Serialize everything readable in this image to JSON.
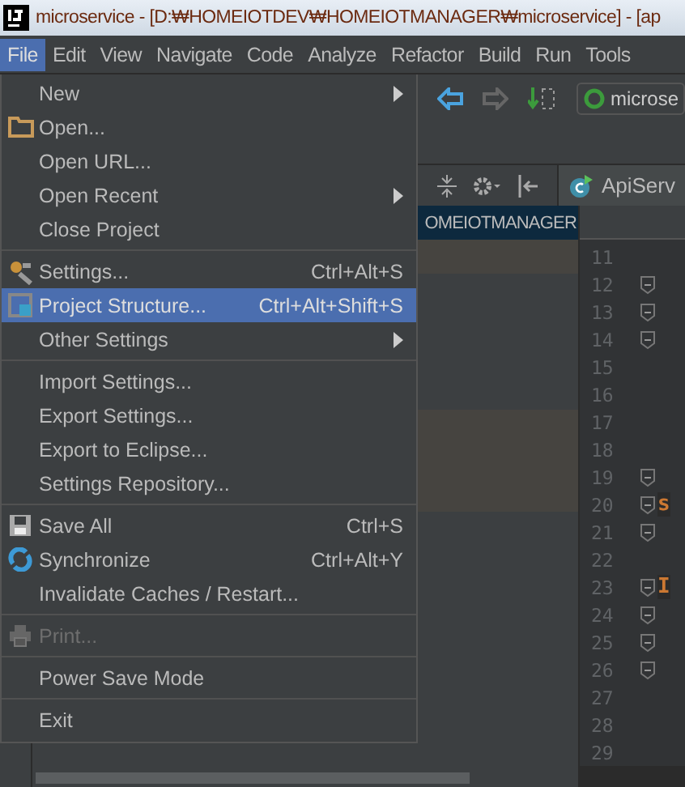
{
  "window": {
    "title": "microservice - [D:₩HOMEIOTDEV₩HOMEIOTMANAGER₩microservice] - [ap"
  },
  "menubar": [
    {
      "label": "File",
      "selected": true
    },
    {
      "label": "Edit",
      "selected": false
    },
    {
      "label": "View",
      "selected": false
    },
    {
      "label": "Navigate",
      "selected": false
    },
    {
      "label": "Code",
      "selected": false
    },
    {
      "label": "Analyze",
      "selected": false
    },
    {
      "label": "Refactor",
      "selected": false
    },
    {
      "label": "Build",
      "selected": false
    },
    {
      "label": "Run",
      "selected": false
    },
    {
      "label": "Tools",
      "selected": false
    }
  ],
  "file_menu": [
    [
      {
        "label": "New",
        "submenu": true,
        "selected": false,
        "disabled": false
      },
      {
        "label": "Open...",
        "selected": false,
        "disabled": false
      },
      {
        "label": "Open URL...",
        "selected": false,
        "disabled": false
      },
      {
        "label": "Open Recent",
        "submenu": true,
        "selected": false,
        "disabled": false
      },
      {
        "label": "Close Project",
        "selected": false,
        "disabled": false
      }
    ],
    [
      {
        "label": "Settings...",
        "shortcut": "Ctrl+Alt+S",
        "selected": false,
        "disabled": false
      },
      {
        "label": "Project Structure...",
        "shortcut": "Ctrl+Alt+Shift+S",
        "selected": true,
        "disabled": false
      },
      {
        "label": "Other Settings",
        "submenu": true,
        "selected": false,
        "disabled": false
      }
    ],
    [
      {
        "label": "Import Settings...",
        "selected": false,
        "disabled": false
      },
      {
        "label": "Export Settings...",
        "selected": false,
        "disabled": false
      },
      {
        "label": "Export to Eclipse...",
        "selected": false,
        "disabled": false
      },
      {
        "label": "Settings Repository...",
        "selected": false,
        "disabled": false
      }
    ],
    [
      {
        "label": "Save All",
        "shortcut": "Ctrl+S",
        "selected": false,
        "disabled": false
      },
      {
        "label": "Synchronize",
        "shortcut": "Ctrl+Alt+Y",
        "selected": false,
        "disabled": false
      },
      {
        "label": "Invalidate Caches / Restart...",
        "selected": false,
        "disabled": false
      }
    ],
    [
      {
        "label": "Print...",
        "selected": false,
        "disabled": true
      }
    ],
    [
      {
        "label": "Power Save Mode",
        "selected": false,
        "disabled": false
      }
    ],
    [
      {
        "label": "Exit",
        "selected": false,
        "disabled": false
      }
    ]
  ],
  "toolbar": {
    "run_config": "microse"
  },
  "project_panel": {
    "path": "OMEIOTMANAGER"
  },
  "editor": {
    "tab": "ApiServ",
    "lines": [
      {
        "number": "11"
      },
      {
        "number": "12"
      },
      {
        "number": "13"
      },
      {
        "number": "14"
      },
      {
        "number": "15"
      },
      {
        "number": "16"
      },
      {
        "number": "17"
      },
      {
        "number": "18"
      },
      {
        "number": "19"
      },
      {
        "number": "20",
        "code": "s"
      },
      {
        "number": "21"
      },
      {
        "number": "22"
      },
      {
        "number": "23",
        "code": "I"
      },
      {
        "number": "24"
      },
      {
        "number": "25"
      },
      {
        "number": "26"
      },
      {
        "number": "27"
      },
      {
        "number": "28"
      },
      {
        "number": "29"
      }
    ]
  }
}
